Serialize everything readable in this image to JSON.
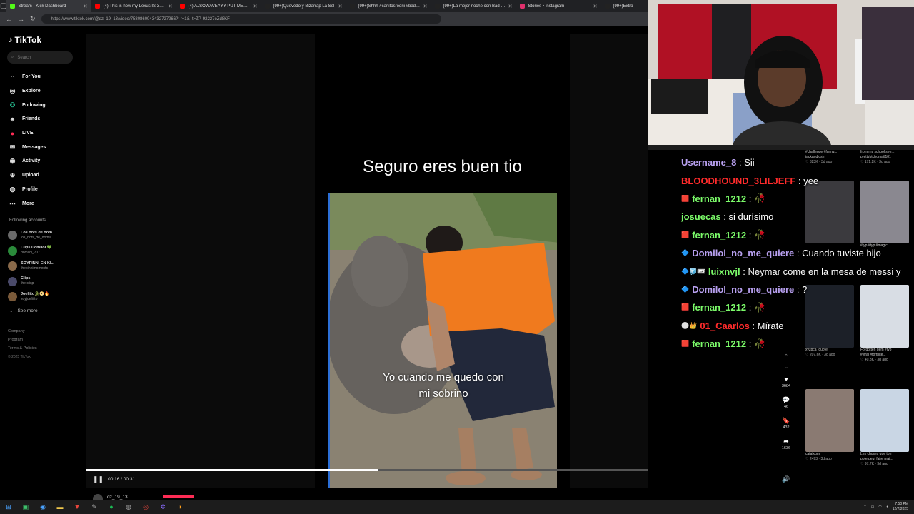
{
  "browser": {
    "tabs": [
      {
        "title": "Stream - Kick Dashboard",
        "color": "#53fc18"
      },
      {
        "title": "(4) This is how my Lexus IS 350 lo",
        "color": "#ff0000"
      },
      {
        "title": "(4) AJSOWAVEYYY PUT MEMO Cl",
        "color": "#ff0000"
      },
      {
        "title": "(99+)Quevedo y Bizarrap La Sel",
        "color": "#222222"
      },
      {
        "title": "(99+)Shhh #carlitosrodrii #badbu",
        "color": "#222222"
      },
      {
        "title": "(99+)La mejor noche con Bad Bu",
        "color": "#222222"
      },
      {
        "title": "Stories • Instagram",
        "color": "#e1306c"
      },
      {
        "title": "(99+)Extra",
        "color": "#222222"
      }
    ],
    "url": "https://www.tiktok.com/@dz_19_13/video/7580860043432727966?_r=1&_t=ZP-92227eZd8KF"
  },
  "sidebar": {
    "logo": "TikTok",
    "search_placeholder": "Search",
    "nav": [
      {
        "label": "For You",
        "icon": "home-icon",
        "glyph": "⌂"
      },
      {
        "label": "Explore",
        "icon": "compass-icon",
        "glyph": "◎"
      },
      {
        "label": "Following",
        "icon": "following-icon",
        "glyph": "⚇"
      },
      {
        "label": "Friends",
        "icon": "friends-icon",
        "glyph": "☻"
      },
      {
        "label": "LIVE",
        "icon": "live-icon",
        "glyph": "●"
      },
      {
        "label": "Messages",
        "icon": "messages-icon",
        "glyph": "✉"
      },
      {
        "label": "Activity",
        "icon": "activity-icon",
        "glyph": "◉"
      },
      {
        "label": "Upload",
        "icon": "upload-icon",
        "glyph": "⊕"
      },
      {
        "label": "Profile",
        "icon": "profile-icon",
        "glyph": "◍"
      },
      {
        "label": "More",
        "icon": "more-icon",
        "glyph": "⋯"
      }
    ],
    "following_title": "Following accounts",
    "following": [
      {
        "name": "Los bots de dom...",
        "handle": "los_bots_de_domil"
      },
      {
        "name": "Clips Domilol 💚",
        "handle": "domilol_707"
      },
      {
        "name": "SOYPINNI EN KI...",
        "handle": "thepinnimoments"
      },
      {
        "name": "Clips",
        "handle": "the.clisp"
      },
      {
        "name": "Joeliito🐊📀🔥",
        "handle": "soyjoelii.to"
      }
    ],
    "see_more": "See more",
    "footer": [
      "Company",
      "Program",
      "Terms & Policies"
    ],
    "copyright": "© 2025 TikTok"
  },
  "video": {
    "heading": "Seguro eres buen tio",
    "caption_line1": "Yo cuando me quedo con",
    "caption_line2": "mi sobrino",
    "time": "00:16 / 00:31",
    "progress": 0.52,
    "author": "dz_19_13"
  },
  "actions": {
    "likes": "3684",
    "comments": "46",
    "saves": "432",
    "shares": "1636"
  },
  "chat": [
    {
      "user": "Username_8",
      "color": "#b8a0f0",
      "msg": "Sii",
      "badge": ""
    },
    {
      "user": "BLOODHOUND_3LILJEFF",
      "color": "#ff2b2b",
      "msg": "yee",
      "badge": ""
    },
    {
      "user": "fernan_1212",
      "color": "#7cfc6a",
      "msg": "🥀",
      "badge": "🟥"
    },
    {
      "user": "josuecas",
      "color": "#7cfc6a",
      "msg": "si durísimo",
      "badge": ""
    },
    {
      "user": "fernan_1212",
      "color": "#7cfc6a",
      "msg": "🥀",
      "badge": "🟥"
    },
    {
      "user": "Domilol_no_me_quiere",
      "color": "#b8a0f0",
      "msg": "Cuando tuviste hijo",
      "badge": "🔷"
    },
    {
      "user": "luixnvjl",
      "color": "#7cfc6a",
      "msg": "Neymar come en la mesa de messi y",
      "badge": "🔷🧊🎟"
    },
    {
      "user": "Domilol_no_me_quiere",
      "color": "#b8a0f0",
      "msg": "?",
      "badge": "🔷"
    },
    {
      "user": "fernan_1212",
      "color": "#7cfc6a",
      "msg": "🥀",
      "badge": "🟥"
    },
    {
      "user": "01_Caarlos",
      "color": "#ff2b2b",
      "msg": "Mírate",
      "badge": "⚪👑"
    },
    {
      "user": "fernan_1212",
      "color": "#7cfc6a",
      "msg": "🥀",
      "badge": "🟥"
    }
  ],
  "thumbs_left": [
    {
      "meta": "#challenge #funny...",
      "user": "jackandjosh",
      "stat": "♡ 323K · 3d ago"
    },
    {
      "meta": "",
      "user": "",
      "stat": ""
    },
    {
      "meta": "xyzbca_quote",
      "user": "",
      "stat": "♡ 207.6K · 3d ago"
    },
    {
      "meta": "catalxgm",
      "user": "",
      "stat": "♡ 2493 · 3d ago"
    }
  ],
  "thumbs_right": [
    {
      "meta": "from my school see...",
      "user": "prettybtcfromatl101",
      "stat": "♡ 171.2K · 3d ago"
    },
    {
      "meta": "#fyp #typ #magic",
      "user": "",
      "stat": ""
    },
    {
      "meta": "Forgotten gem #fyp",
      "user": "#viral #fortnite...",
      "stat": "♡ 40.3K · 3d ago"
    },
    {
      "meta": "Les choses que ton",
      "user": "pote peut faire mai...",
      "stat": "♡ 97.7K · 3d ago"
    }
  ],
  "taskbar": {
    "time": "7:50 PM",
    "date": "12/7/2025"
  }
}
